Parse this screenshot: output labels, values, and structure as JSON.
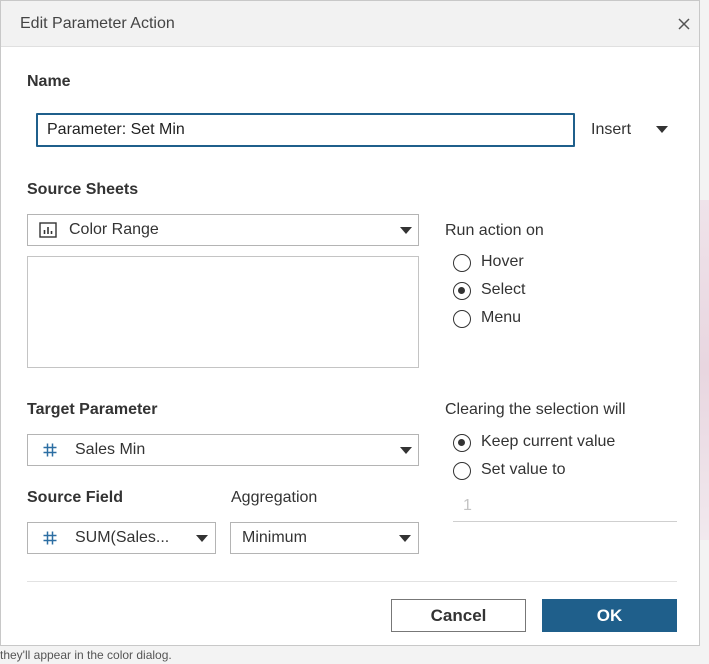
{
  "dialog": {
    "title": "Edit Parameter Action"
  },
  "name_section": {
    "label": "Name",
    "value": "Parameter: Set Min",
    "insert_label": "Insert"
  },
  "source_sheets": {
    "label": "Source Sheets",
    "selected": "Color Range",
    "selected_icon": "bar-chart-icon"
  },
  "run_action": {
    "label": "Run action on",
    "options": [
      "Hover",
      "Select",
      "Menu"
    ],
    "selected": "Select"
  },
  "target_parameter": {
    "label": "Target Parameter",
    "selected": "Sales Min",
    "icon": "number-hash-icon"
  },
  "clearing": {
    "label": "Clearing the selection will",
    "options": [
      "Keep current value",
      "Set value to"
    ],
    "selected": "Keep current value",
    "set_value": "1"
  },
  "source_field": {
    "label": "Source Field",
    "selected": "SUM(Sales...",
    "icon": "number-hash-icon"
  },
  "aggregation": {
    "label": "Aggregation",
    "selected": "Minimum"
  },
  "buttons": {
    "cancel": "Cancel",
    "ok": "OK"
  },
  "background": {
    "snippet": "they'll appear in the color dialog."
  },
  "colors": {
    "accent": "#1f5f8b",
    "title_bar": "#f2f2f2",
    "border": "#b4b4b4"
  }
}
